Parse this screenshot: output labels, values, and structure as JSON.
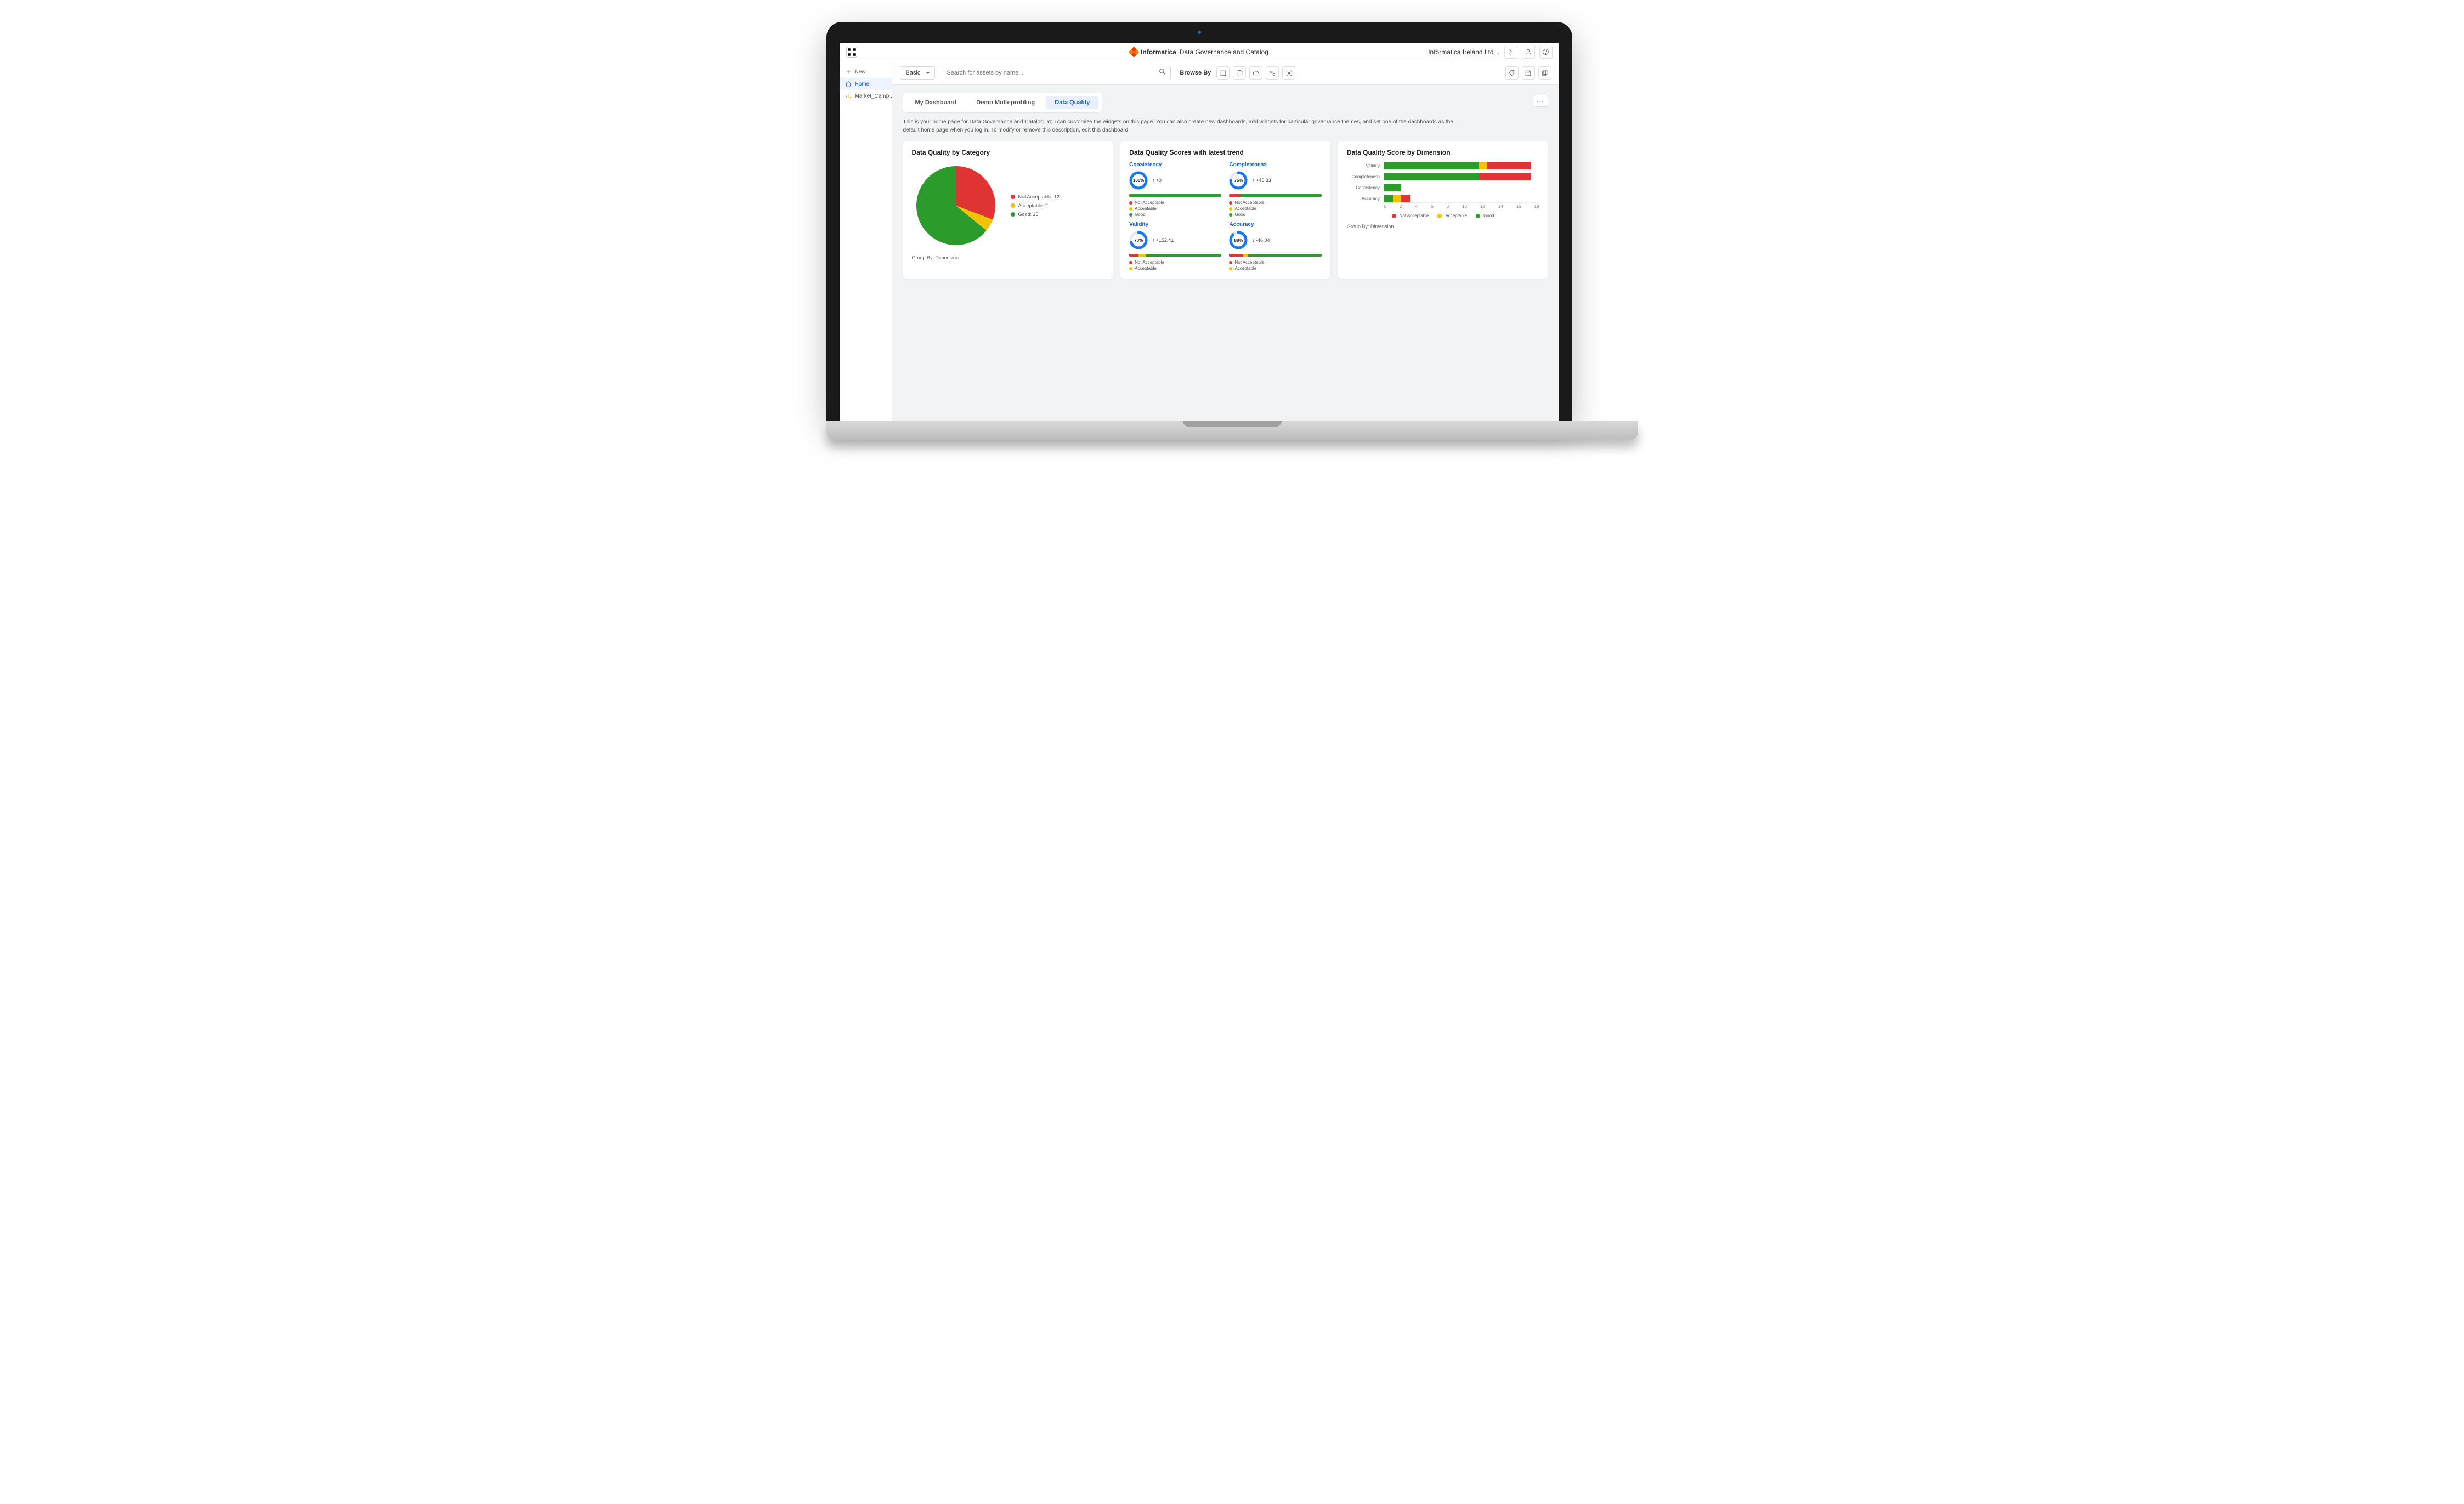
{
  "colors": {
    "good": "#2b9c2b",
    "acceptable": "#f2c300",
    "not_acceptable": "#e03333",
    "accent": "#1261d6",
    "donut": "#1877f2"
  },
  "topbar": {
    "brand_name": "Informatica",
    "app_title": "Data Governance and Catalog",
    "org": "Informatica Ireland Ltd"
  },
  "sidebar": {
    "items": [
      {
        "label": "New",
        "icon": "plus"
      },
      {
        "label": "Home",
        "icon": "home",
        "active": true
      },
      {
        "label": "Market_Camp...",
        "icon": "bar-chart"
      }
    ]
  },
  "search": {
    "mode": "Basic",
    "placeholder": "Search for assets by name...",
    "browse_by": "Browse By"
  },
  "tabs": [
    {
      "label": "My Dashboard",
      "active": false
    },
    {
      "label": "Demo Multi-profiling",
      "active": false
    },
    {
      "label": "Data Quality",
      "active": true
    }
  ],
  "description": "This is your home page for Data Governance and Catalog. You can customize the widgets on this page. You can also create new dashboards, add widgets for particular governance themes, and set one of the dashboards as the default home page when you log in. To modify or remove this description, edit this dashboard.",
  "card1": {
    "title": "Data Quality by Category",
    "group_by": "Group By: Dimension",
    "legend": [
      {
        "label": "Not Acceptable: 12",
        "color": "#e03333"
      },
      {
        "label": "Acceptable: 2",
        "color": "#f2c300"
      },
      {
        "label": "Good: 25",
        "color": "#2b9c2b"
      }
    ]
  },
  "card2": {
    "title": "Data Quality Scores with latest trend",
    "scores": [
      {
        "name": "Consistency",
        "value": "100%",
        "pct": 100,
        "trend": "+0",
        "dir": "up",
        "bar": [
          {
            "c": "#2b9c2b",
            "w": 100
          }
        ],
        "legend": [
          "Not Acceptable",
          "Acceptable",
          "Good"
        ]
      },
      {
        "name": "Completeness",
        "value": "75%",
        "pct": 75,
        "trend": "+45.33",
        "dir": "up",
        "bar": [
          {
            "c": "#e03333",
            "w": 12
          },
          {
            "c": "#f2c300",
            "w": 0
          },
          {
            "c": "#2b9c2b",
            "w": 88
          }
        ],
        "legend": [
          "Not Acceptable",
          "Acceptable",
          "Good"
        ]
      },
      {
        "name": "Validity",
        "value": "70%",
        "pct": 70,
        "trend": "+152.41",
        "dir": "up",
        "bar": [
          {
            "c": "#e03333",
            "w": 10
          },
          {
            "c": "#f2c300",
            "w": 8
          },
          {
            "c": "#2b9c2b",
            "w": 82
          }
        ],
        "legend": [
          "Not Acceptable",
          "Acceptable"
        ]
      },
      {
        "name": "Accuracy",
        "value": "88%",
        "pct": 88,
        "trend": "-46.04",
        "dir": "down",
        "bar": [
          {
            "c": "#e03333",
            "w": 15
          },
          {
            "c": "#f2c300",
            "w": 5
          },
          {
            "c": "#2b9c2b",
            "w": 80
          }
        ],
        "legend": [
          "Not Acceptable",
          "Acceptable"
        ]
      }
    ]
  },
  "card3": {
    "title": "Data Quality Score by Dimension",
    "group_by": "Group By: Dimension",
    "rows": [
      {
        "label": "Validity",
        "seg": [
          {
            "c": "#2b9c2b",
            "v": 11
          },
          {
            "c": "#f2c300",
            "v": 1
          },
          {
            "c": "#e03333",
            "v": 5
          }
        ]
      },
      {
        "label": "Completeness",
        "seg": [
          {
            "c": "#2b9c2b",
            "v": 11
          },
          {
            "c": "#e03333",
            "v": 6
          }
        ]
      },
      {
        "label": "Consistency",
        "seg": [
          {
            "c": "#2b9c2b",
            "v": 2
          }
        ]
      },
      {
        "label": "Accuracy",
        "seg": [
          {
            "c": "#2b9c2b",
            "v": 1
          },
          {
            "c": "#f2c300",
            "v": 1
          },
          {
            "c": "#e03333",
            "v": 1
          }
        ]
      }
    ],
    "axis": [
      "0",
      "2",
      "4",
      "6",
      "8",
      "10",
      "12",
      "14",
      "16",
      "18"
    ],
    "max": 18,
    "legend": [
      {
        "label": "Not Acceptable",
        "color": "#e03333"
      },
      {
        "label": "Acceptable",
        "color": "#f2c300"
      },
      {
        "label": "Good",
        "color": "#2b9c2b"
      }
    ]
  },
  "chart_data": [
    {
      "type": "pie",
      "title": "Data Quality by Category",
      "series": [
        {
          "name": "Not Acceptable",
          "value": 12
        },
        {
          "name": "Acceptable",
          "value": 2
        },
        {
          "name": "Good",
          "value": 25
        }
      ]
    },
    {
      "type": "bar",
      "title": "Data Quality Score by Dimension",
      "categories": [
        "Validity",
        "Completeness",
        "Consistency",
        "Accuracy"
      ],
      "series": [
        {
          "name": "Good",
          "values": [
            11,
            11,
            2,
            1
          ]
        },
        {
          "name": "Acceptable",
          "values": [
            1,
            0,
            0,
            1
          ]
        },
        {
          "name": "Not Acceptable",
          "values": [
            5,
            6,
            0,
            1
          ]
        }
      ],
      "xlabel": "",
      "ylabel": "",
      "ylim": [
        0,
        18
      ]
    }
  ]
}
